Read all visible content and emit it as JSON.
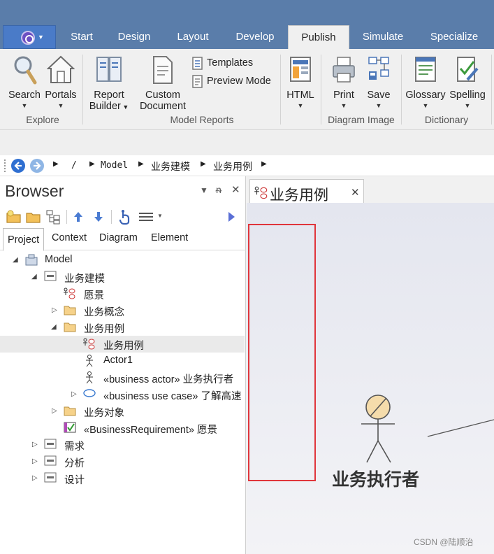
{
  "ribbon": {
    "tabs": [
      "Start",
      "Design",
      "Layout",
      "Develop",
      "Publish",
      "Simulate",
      "Specialize"
    ],
    "active_tab": "Publish",
    "explore": {
      "search": "Search",
      "portals": "Portals",
      "group": "Explore"
    },
    "model_reports": {
      "report_builder_1": "Report",
      "report_builder_2": "Builder",
      "custom_document_1": "Custom",
      "custom_document_2": "Document",
      "templates": "Templates",
      "preview_mode": "Preview Mode",
      "html": "HTML",
      "group": "Model Reports"
    },
    "diagram_image": {
      "print": "Print",
      "save": "Save",
      "group": "Diagram Image"
    },
    "dictionary": {
      "glossary": "Glossary",
      "spelling": "Spelling",
      "group": "Dictionary"
    }
  },
  "breadcrumb": {
    "items": [
      "/",
      "Model",
      "业务建模",
      "业务用例"
    ]
  },
  "browser": {
    "title": "Browser",
    "tabs": [
      "Project",
      "Context",
      "Diagram",
      "Element"
    ],
    "active_tab": "Project",
    "tree": [
      {
        "label": "Model"
      },
      {
        "label": "业务建模"
      },
      {
        "label": "愿景"
      },
      {
        "label": "业务概念"
      },
      {
        "label": "业务用例"
      },
      {
        "label": "业务用例"
      },
      {
        "label": "Actor1"
      },
      {
        "label": "«business actor» 业务执行者"
      },
      {
        "label": "«business use case» 了解高速"
      },
      {
        "label": "业务对象"
      },
      {
        "label": "«BusinessRequirement» 愿景"
      },
      {
        "label": "需求"
      },
      {
        "label": "分析"
      },
      {
        "label": "设计"
      }
    ]
  },
  "diagram": {
    "tab_title": "业务用例",
    "actor_name": "业务执行者",
    "watermark": "CSDN @陆顺治"
  },
  "colors": {
    "tabbar": "#5a7daa",
    "app_button": "#4a7bc8",
    "highlight_box": "#e0353b",
    "actor_head": "#f5dcab"
  }
}
